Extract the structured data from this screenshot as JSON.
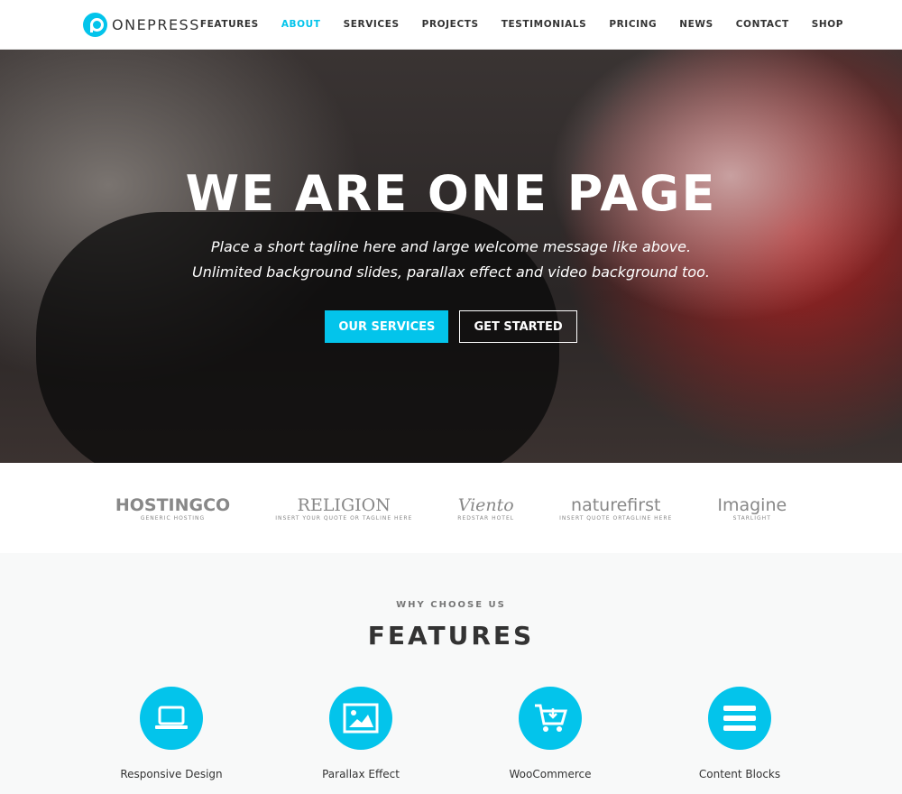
{
  "brand": {
    "name": "ONEPRESS",
    "accent": "#03c4eb"
  },
  "nav": [
    {
      "label": "FEATURES"
    },
    {
      "label": "ABOUT",
      "active": true
    },
    {
      "label": "SERVICES"
    },
    {
      "label": "PROJECTS"
    },
    {
      "label": "TESTIMONIALS"
    },
    {
      "label": "PRICING"
    },
    {
      "label": "NEWS"
    },
    {
      "label": "CONTACT"
    },
    {
      "label": "SHOP"
    }
  ],
  "hero": {
    "title": "WE ARE ONE PAGE",
    "tagline1": "Place a short tagline here and large welcome message like above.",
    "tagline2": "Unlimited background slides, parallax effect and video background too.",
    "primary_button": "OUR SERVICES",
    "secondary_button": "GET STARTED"
  },
  "clients": [
    {
      "name": "HOSTINGCO",
      "sub": "GENERIC HOSTING"
    },
    {
      "name": "RELIGION",
      "sub": "INSERT YOUR QUOTE OR TAGLINE HERE"
    },
    {
      "name": "Viento",
      "sub": "REDSTAR HOTEL"
    },
    {
      "name": "naturefirst",
      "sub": "INSERT QUOTE ORTAGLINE HERE"
    },
    {
      "name": "Imagine",
      "sub": "STARLIGHT"
    }
  ],
  "features": {
    "subtitle": "WHY CHOOSE US",
    "title": "FEATURES",
    "items": [
      {
        "label": "Responsive Design",
        "icon": "laptop-icon"
      },
      {
        "label": "Parallax Effect",
        "icon": "image-icon"
      },
      {
        "label": "WooCommerce",
        "icon": "cart-icon"
      },
      {
        "label": "Content Blocks",
        "icon": "bars-icon"
      }
    ]
  }
}
